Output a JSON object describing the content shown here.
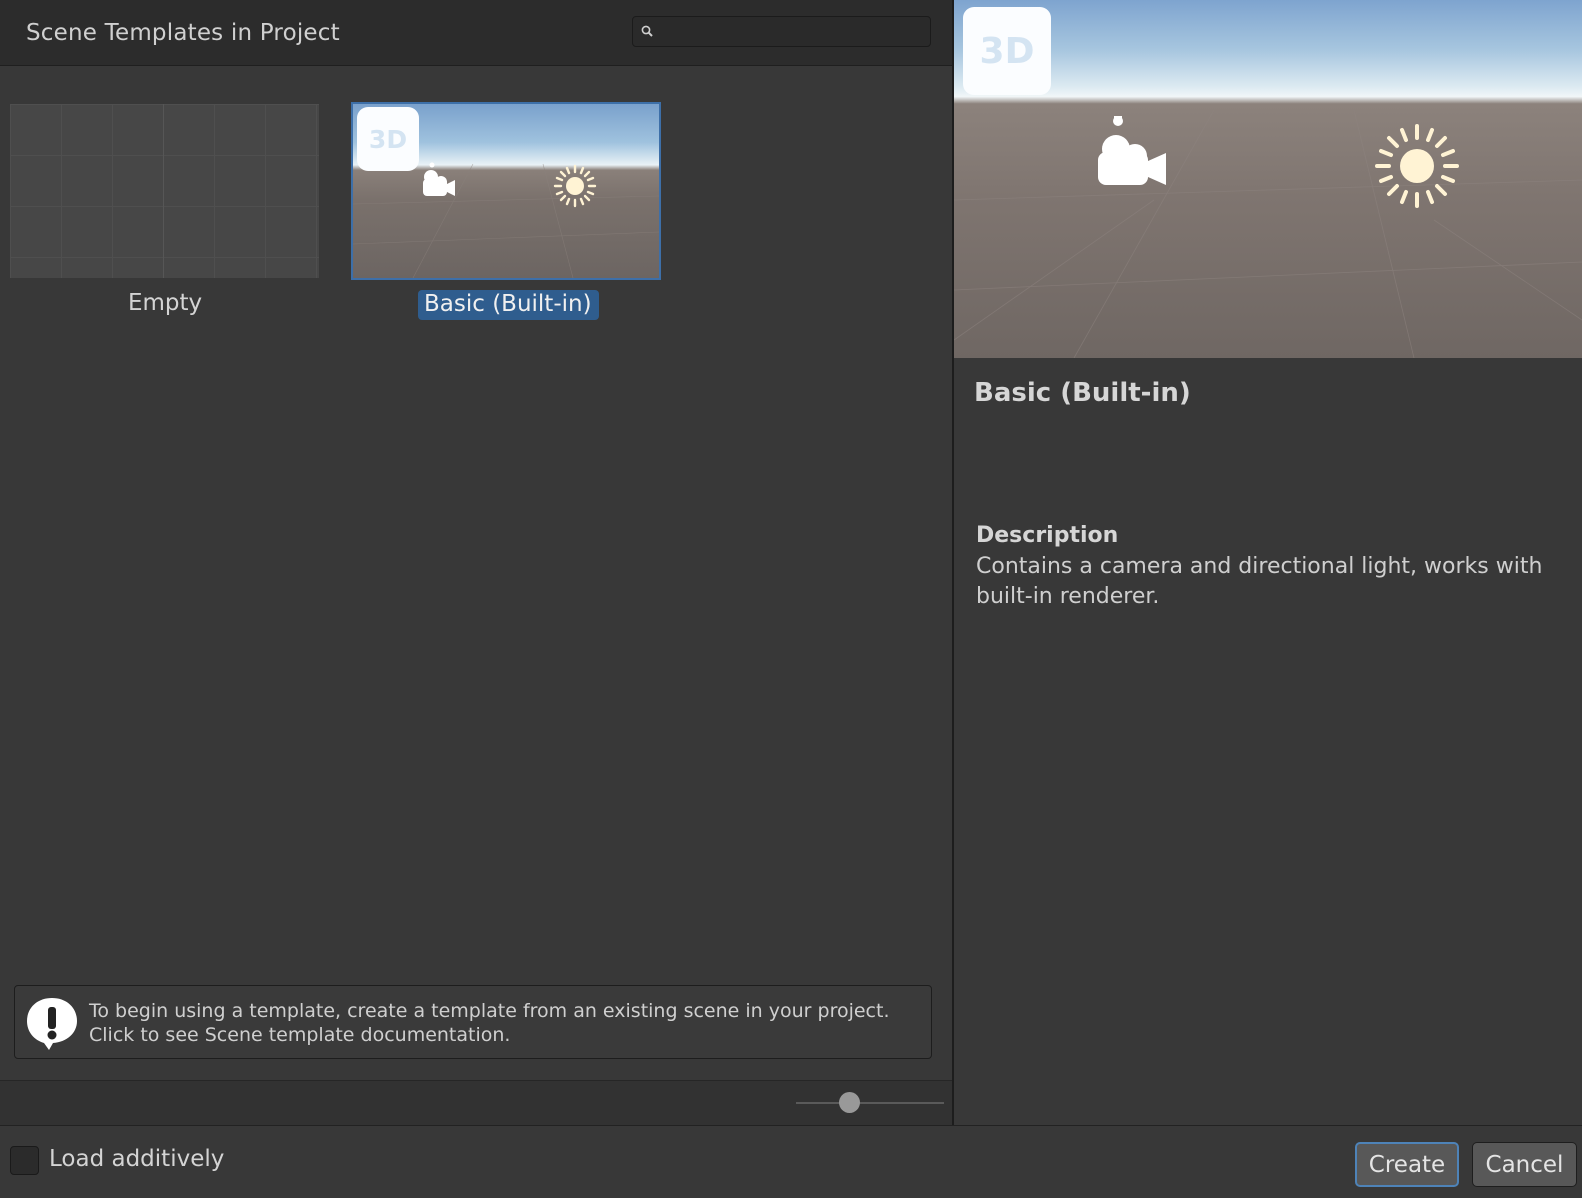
{
  "header": {
    "title": "Scene Templates in Project",
    "search_placeholder": ""
  },
  "templates": [
    {
      "label": "Empty",
      "selected": false
    },
    {
      "label": "Basic (Built-in)",
      "selected": true,
      "badge": "3D"
    }
  ],
  "info": {
    "line1": "To begin using a template, create a template from an existing scene in your project.",
    "line2": "Click to see Scene template documentation."
  },
  "details": {
    "badge": "3D",
    "title": "Basic (Built-in)",
    "description_heading": "Description",
    "description": "Contains a camera and directional light, works with built-in renderer."
  },
  "footer": {
    "load_additively_label": "Load additively",
    "load_additively_checked": false,
    "create_label": "Create",
    "cancel_label": "Cancel"
  },
  "colors": {
    "selection": "#2f5d8e",
    "accent_border": "#4e83b8"
  }
}
